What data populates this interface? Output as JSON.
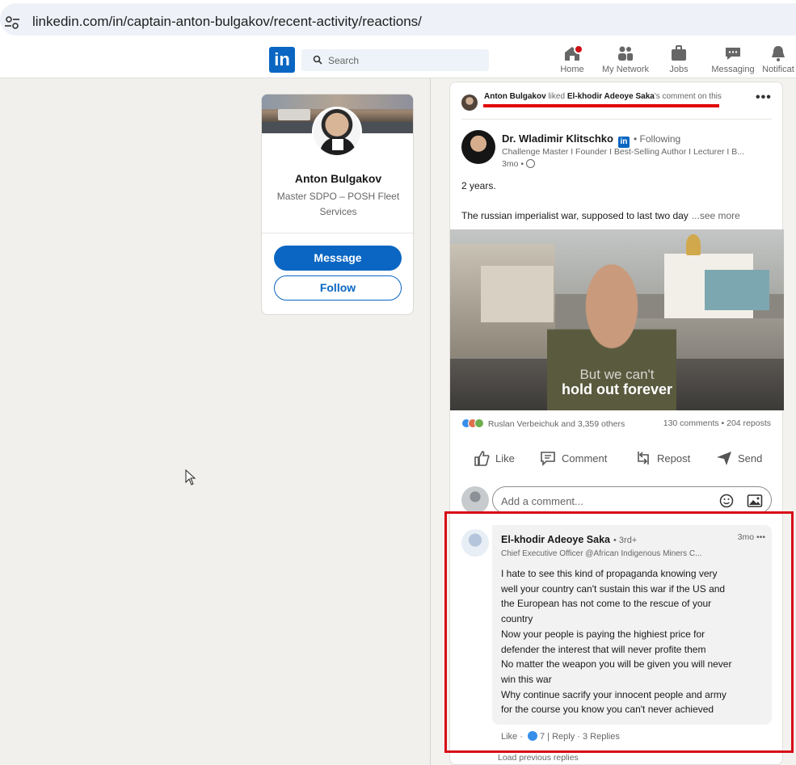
{
  "browser": {
    "url": "linkedin.com/in/captain-anton-bulgakov/recent-activity/reactions/"
  },
  "nav": {
    "logo": "in",
    "search_placeholder": "Search",
    "items": [
      {
        "label": "Home",
        "icon": "home-icon"
      },
      {
        "label": "My Network",
        "icon": "network-icon"
      },
      {
        "label": "Jobs",
        "icon": "briefcase-icon"
      },
      {
        "label": "Messaging",
        "icon": "messaging-icon"
      },
      {
        "label": "Notificat",
        "icon": "bell-icon"
      }
    ]
  },
  "profile": {
    "name": "Anton Bulgakov",
    "headline": "Master SDPO – POSH Fleet Services",
    "message_label": "Message",
    "follow_label": "Follow"
  },
  "post": {
    "activity_actor": "Anton Bulgakov",
    "activity_verb": "liked",
    "activity_target": "El-khodir Adeoye Saka",
    "activity_suffix": "'s comment on this",
    "more_label": "•••",
    "author_name": "Dr. Wladimir Klitschko",
    "author_badge": "in",
    "author_following": "• Following",
    "author_title": "Challenge Master I Founder I Best-Selling Author I Lecturer I B...",
    "author_time": "3mo •",
    "text_line1": "2 years.",
    "text_line2": "The russian imperialist war, supposed to last two day",
    "see_more": "...see more",
    "media_caption_1": "But we can't",
    "media_caption_2": "hold out forever",
    "reactions_text": "Ruslan Verbeichuk and 3,359 others",
    "stats_text": "130 comments • 204 reposts",
    "actions": {
      "like": "Like",
      "comment": "Comment",
      "repost": "Repost",
      "send": "Send"
    },
    "comment_placeholder": "Add a comment..."
  },
  "reply": {
    "name": "El-khodir Adeoye Saka",
    "degree": "• 3rd+",
    "time": "3mo •••",
    "title": "Chief Executive Officer @African Indigenous Miners C...",
    "lines": [
      "I hate to see this kind of propaganda knowing very",
      "well your country can't sustain this war if the US and",
      "the European has not come to the rescue of your",
      "country",
      "Now your people is paying the highiest price for",
      "defender the interest that will never profite them",
      "No matter the weapon you will be given you will never",
      "win this war",
      "Why continue sacrify your innocent people and army",
      "for the course you know you can't never achieved"
    ],
    "like_label": "Like",
    "like_count": "7",
    "reply_label": "Reply",
    "replies_label": "· 3 Replies",
    "load_previous": "Load previous replies"
  },
  "colors": {
    "brand_blue": "#0a66c2",
    "highlight_red": "#d70b17",
    "background": "#f3f2ef"
  }
}
